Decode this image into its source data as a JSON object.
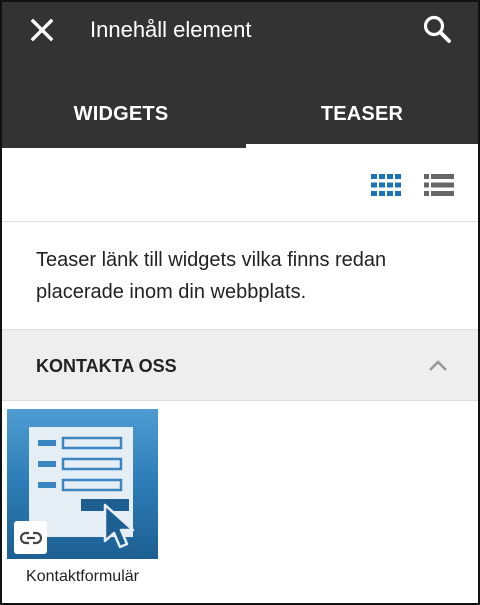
{
  "header": {
    "title": "Innehåll element",
    "close_icon": "close-icon",
    "search_icon": "search-icon"
  },
  "tabs": [
    {
      "label": "WIDGETS",
      "active": false
    },
    {
      "label": "TEASER",
      "active": true
    }
  ],
  "view_toggle": {
    "grid_icon": "grid-view-icon",
    "list_icon": "list-view-icon",
    "active": "grid"
  },
  "description": "Teaser länk till widgets vilka finns redan placerade inom din webbplats.",
  "category": {
    "title": "KONTAKTA OSS",
    "expanded": true
  },
  "items": [
    {
      "label": "Kontaktformulär",
      "icon": "contact-form-icon",
      "badge_icon": "link-icon"
    }
  ],
  "colors": {
    "header_bg": "#333333",
    "accent_blue": "#1a73b8",
    "category_bg": "#eeeeee"
  }
}
